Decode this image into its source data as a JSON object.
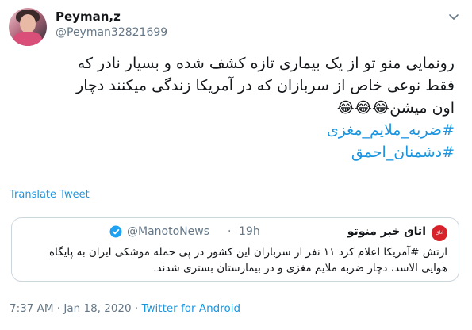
{
  "author": {
    "name": "Peyman,z",
    "handle": "@Peyman32821699"
  },
  "tweet": {
    "lines": [
      "رونمایی منو تو از یک بیماری تازه کشف شده و بسیار نادر که",
      "فقط نوعی خاص از سربازان که در آمریکا زندگی میکنند دچار",
      "اون میشن😂😂😂"
    ],
    "hashtags": [
      "#ضربه_ملایم_مغزی",
      "#دشمنان_احمق"
    ]
  },
  "translate_label": "Translate Tweet",
  "quote": {
    "avatar_text": "اتاق خبر",
    "name": "اتاق خبر منوتو",
    "handle": "@ManotoNews",
    "dot": "·",
    "time": "19h",
    "lines": [
      "ارتش #آمریکا اعلام کرد ۱۱ نفر از سربازان این کشور در پی حمله موشکی ایران به پایگاه",
      "هوایی الاسد، دچار ضربه ملایم مغزی و در بیمارستان بستری شدند."
    ]
  },
  "footer": {
    "time": "7:37 AM",
    "separator": " · ",
    "date": "Jan 18, 2020",
    "source": "Twitter for Android"
  },
  "colors": {
    "link": "#1b95e0",
    "secondary_text": "#657786",
    "border": "#ccd6dd"
  },
  "icons": {
    "caret": "chevron-down-icon",
    "verified": "verified-badge-icon"
  }
}
